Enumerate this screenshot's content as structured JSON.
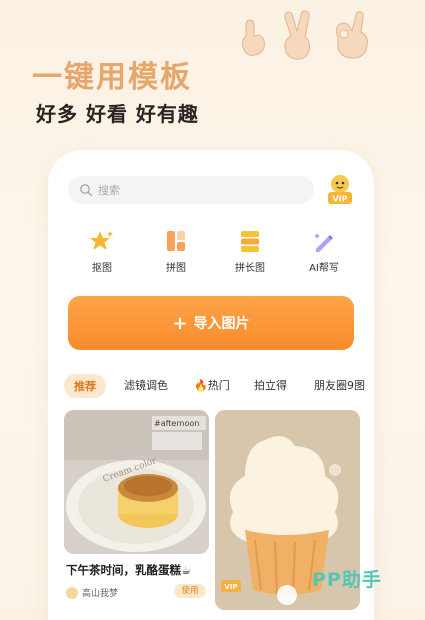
{
  "promo": {
    "headline": "一键用模板",
    "subline": "好多 好看 好有趣"
  },
  "search": {
    "placeholder": "搜索"
  },
  "features": [
    {
      "label": "抠图",
      "icon": "star-sparkle-icon"
    },
    {
      "label": "拼图",
      "icon": "collage-icon"
    },
    {
      "label": "拼长图",
      "icon": "long-image-icon"
    },
    {
      "label": "AI帮写",
      "icon": "ai-pen-icon"
    }
  ],
  "import_button": {
    "label": "导入图片"
  },
  "tabs": [
    {
      "label": "推荐",
      "active": true
    },
    {
      "label": "滤镜调色",
      "active": false
    },
    {
      "label": "🔥热门",
      "active": false
    },
    {
      "label": "拍立得",
      "active": false
    },
    {
      "label": "朋友圈9图",
      "active": false
    }
  ],
  "cards": [
    {
      "title": "下午茶时间，乳酪蛋糕☕",
      "author": "高山我梦",
      "use_label": "使用",
      "photo_text": "#afternoon",
      "plate_text": "Cream color"
    },
    {
      "badge": "VIP"
    }
  ],
  "vip_label": "VIP",
  "watermark": "PP助手",
  "colors": {
    "accent": "#f98b2d",
    "headline": "#e7a76a",
    "watermark": "#53c6b7"
  }
}
